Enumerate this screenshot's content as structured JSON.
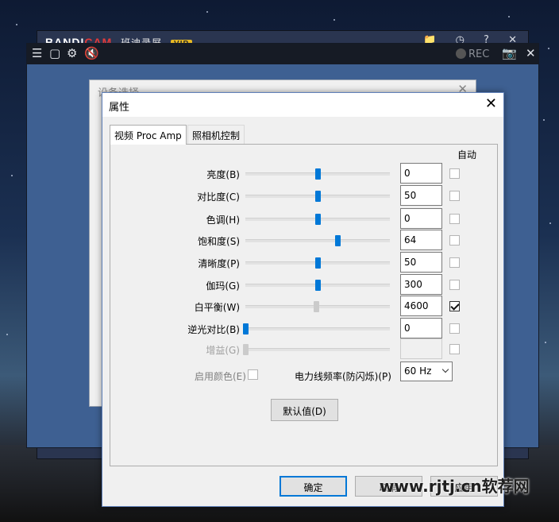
{
  "bandicam": {
    "logo_prefix": "BANDI",
    "logo_suffix": "CAM",
    "name_cn": "班迪录屏",
    "vip": "VIP",
    "rec_label": "REC"
  },
  "settings_window": {
    "title": "设备选择"
  },
  "dialog": {
    "title": "属性",
    "close_glyph": "✕",
    "tabs": [
      {
        "label": "视频 Proc Amp",
        "active": true
      },
      {
        "label": "照相机控制",
        "active": false
      }
    ],
    "auto_header": "自动",
    "rows": [
      {
        "label": "亮度(B)",
        "value": "0",
        "slider_pct": 0.5,
        "auto": false,
        "disabled": false
      },
      {
        "label": "对比度(C)",
        "value": "50",
        "slider_pct": 0.5,
        "auto": false,
        "disabled": false
      },
      {
        "label": "色调(H)",
        "value": "0",
        "slider_pct": 0.5,
        "auto": false,
        "disabled": false
      },
      {
        "label": "饱和度(S)",
        "value": "64",
        "slider_pct": 0.64,
        "auto": false,
        "disabled": false
      },
      {
        "label": "清晰度(P)",
        "value": "50",
        "slider_pct": 0.5,
        "auto": false,
        "disabled": false
      },
      {
        "label": "伽玛(G)",
        "value": "300",
        "slider_pct": 0.5,
        "auto": false,
        "disabled": false
      },
      {
        "label": "白平衡(W)",
        "value": "4600",
        "slider_pct": 0.49,
        "auto": true,
        "disabled": false
      },
      {
        "label": "逆光对比(B)",
        "value": "0",
        "slider_pct": 0.0,
        "auto": false,
        "disabled": false
      },
      {
        "label": "增益(G)",
        "value": "",
        "slider_pct": 0.0,
        "auto": false,
        "disabled": true
      }
    ],
    "enable_color_label": "启用颜色(E)",
    "power_freq_label": "电力线频率(防闪烁)(P)",
    "power_freq_value": "60 Hz",
    "default_button": "默认值(D)",
    "ok_button": "确定",
    "cancel_button": "取消",
    "apply_button": "应用"
  },
  "watermark": "www.rjtj.cn软荐网",
  "colors": {
    "accent": "#0078d7",
    "bandicam_blue": "#3e6092",
    "bandicam_red": "#e23a3a"
  }
}
